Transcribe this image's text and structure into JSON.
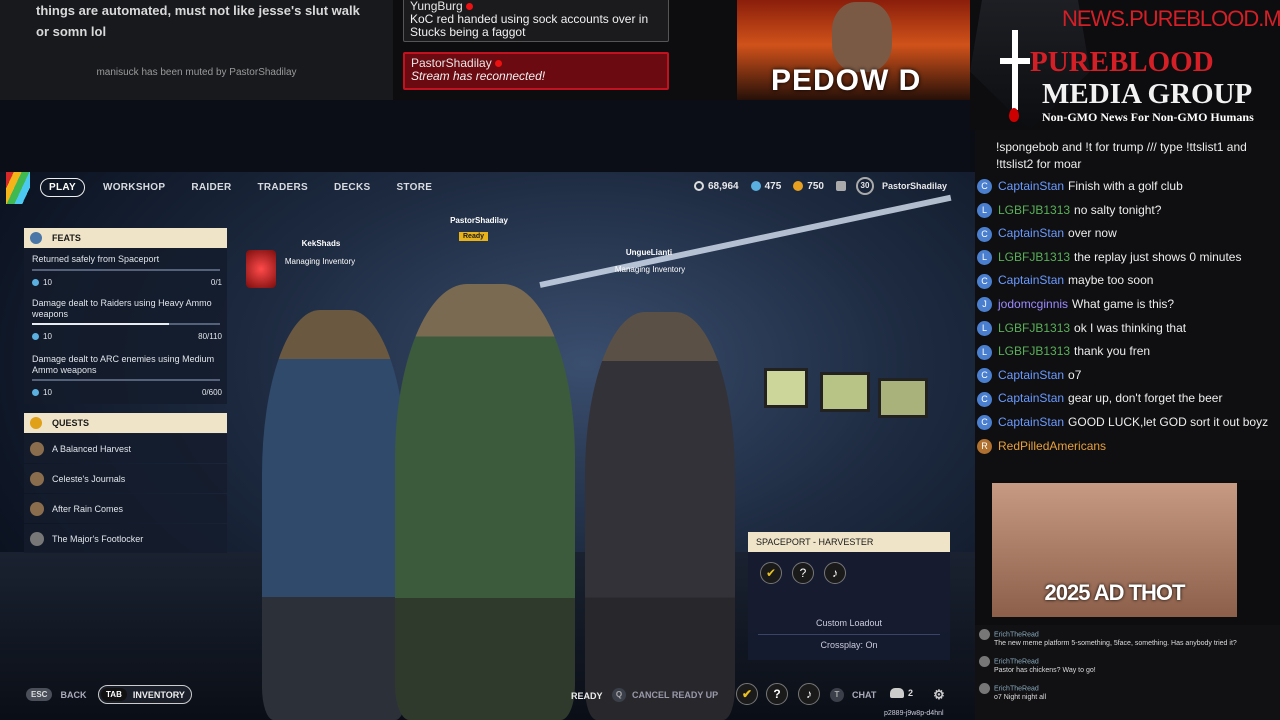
{
  "top_left": {
    "message": "things are automated, must not like jesse's slut walk or somn lol",
    "muted_notice": "manisuck has been muted by PastorShadilay"
  },
  "top_chat": {
    "msg1_user": "YungBurg",
    "msg1_text": "KoC red handed using sock accounts over in Stucks being a faggot",
    "msg2_user": "PastorShadilay",
    "msg2_text": "Stream has reconnected!"
  },
  "top_cam": {
    "overlay_text": "PEDOW  D"
  },
  "brand": {
    "url": "NEWS.PUREBLOOD.MEDIA",
    "line1": "PUREBLOOD",
    "line2": "MEDIA GROUP",
    "tagline": "Non-GMO News For Non-GMO Humans"
  },
  "game": {
    "nav": [
      "PLAY",
      "WORKSHOP",
      "RAIDER",
      "TRADERS",
      "DECKS",
      "STORE"
    ],
    "currency": {
      "coins": "68,964",
      "creds": "475",
      "tokens": "750",
      "level": "30",
      "username": "PastorShadilay"
    },
    "feats_title": "FEATS",
    "feats": [
      {
        "title": "Returned safely from Spaceport",
        "reward": "10",
        "progress": "0/1",
        "fill": 0.0
      },
      {
        "title": "Damage dealt to Raiders using Heavy Ammo weapons",
        "reward": "10",
        "progress": "80/110",
        "fill": 0.73
      },
      {
        "title": "Damage dealt to ARC enemies using Medium Ammo weapons",
        "reward": "10",
        "progress": "0/600",
        "fill": 0.0
      }
    ],
    "quests_title": "QUESTS",
    "quests": [
      "A Balanced Harvest",
      "Celeste's Journals",
      "After Rain Comes",
      "The Major's Footlocker"
    ],
    "players": [
      {
        "name": "KekShads",
        "status": "Managing Inventory"
      },
      {
        "name": "PastorShadilay",
        "status": "Ready"
      },
      {
        "name": "UngueLianti",
        "status": "Managing Inventory"
      }
    ],
    "loadout": {
      "title": "SPACEPORT - HARVESTER",
      "custom": "Custom Loadout",
      "crossplay": "Crossplay: On"
    },
    "bottom": {
      "esc_key": "ESC",
      "back": "BACK",
      "tab_key": "TAB",
      "inventory": "INVENTORY",
      "ready": "READY",
      "cancel": "CANCEL READY UP",
      "chat": "CHAT",
      "party_count": "2",
      "session_code": "p2889-j9w8p-d4hnl"
    }
  },
  "chat": {
    "intro": "!spongebob and !t for trump /// type !ttslist1 and !ttslist2 for moar",
    "lines": [
      {
        "user": "CaptainStan",
        "text": "Finish with a golf club",
        "avatar": "C",
        "color": "#6b9bff"
      },
      {
        "user": "LGBFJB1313",
        "text": "no salty tonight?",
        "avatar": "L",
        "color": "#5ab05a"
      },
      {
        "user": "CaptainStan",
        "text": "over now",
        "avatar": "C",
        "color": "#6b9bff"
      },
      {
        "user": "LGBFJB1313",
        "text": "the replay just shows 0 minutes",
        "avatar": "L",
        "color": "#5ab05a"
      },
      {
        "user": "CaptainStan",
        "text": "maybe too soon",
        "avatar": "C",
        "color": "#6b9bff"
      },
      {
        "user": "jodomcginnis",
        "text": "What game is this?",
        "avatar": "J",
        "color": "#9b8cff"
      },
      {
        "user": "LGBFJB1313",
        "text": "ok I was thinking that",
        "avatar": "L",
        "color": "#5ab05a"
      },
      {
        "user": "LGBFJB1313",
        "text": "thank you fren",
        "avatar": "L",
        "color": "#5ab05a"
      },
      {
        "user": "CaptainStan",
        "text": "o7",
        "avatar": "C",
        "color": "#6b9bff"
      },
      {
        "user": "CaptainStan",
        "text": "gear up, don't forget the beer",
        "avatar": "C",
        "color": "#6b9bff"
      },
      {
        "user": "CaptainStan",
        "text": "GOOD LUCK,let GOD sort it out boyz",
        "avatar": "C",
        "color": "#6b9bff"
      },
      {
        "user": "RedPilledAmericans",
        "text": "",
        "avatar": "R",
        "color": "#e8a03a"
      }
    ]
  },
  "ad": {
    "caption": "2025 AD THOT"
  },
  "chat2": [
    {
      "user": "ErichTheRead",
      "text": "The new meme platform 5-something, 5face, something. Has anybody tried it?"
    },
    {
      "user": "ErichTheRead",
      "text": "Pastor has chickens? Way to go!"
    },
    {
      "user": "ErichTheRead",
      "text": "o7 Night night all"
    }
  ]
}
